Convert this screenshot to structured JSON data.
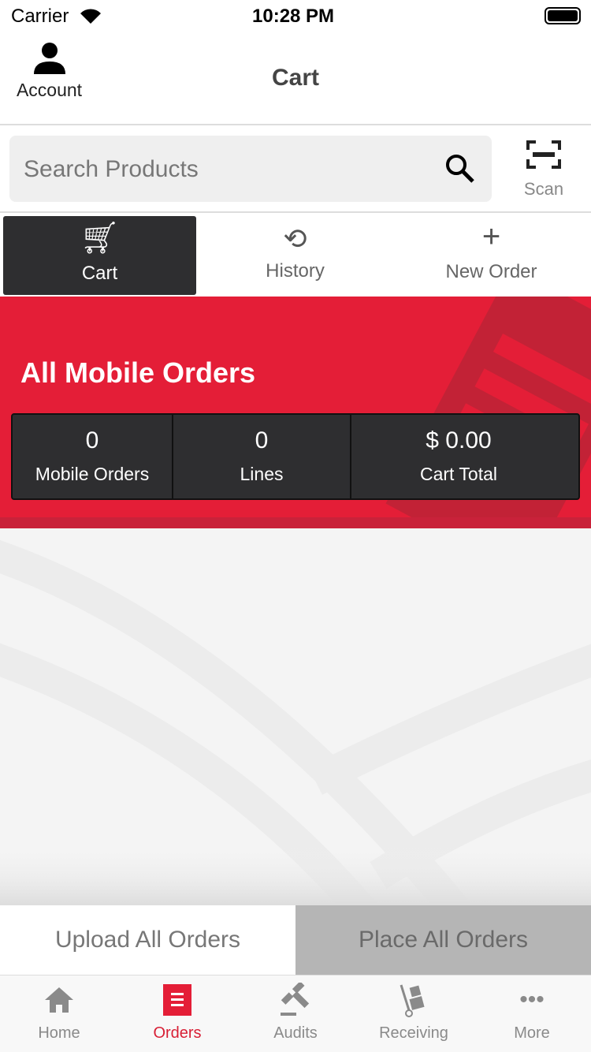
{
  "status": {
    "carrier": "Carrier",
    "time": "10:28 PM"
  },
  "header": {
    "account_label": "Account",
    "title": "Cart"
  },
  "search": {
    "placeholder": "Search Products",
    "scan_label": "Scan"
  },
  "tabs": [
    {
      "label": "Cart"
    },
    {
      "label": "History"
    },
    {
      "label": "New Order"
    }
  ],
  "banner": {
    "title": "All Mobile Orders"
  },
  "stats": [
    {
      "value": "0",
      "label": "Mobile Orders"
    },
    {
      "value": "0",
      "label": "Lines"
    },
    {
      "value": "$ 0.00",
      "label": "Cart Total"
    }
  ],
  "actions": {
    "upload": "Upload All Orders",
    "place": "Place All Orders"
  },
  "tabbar": [
    {
      "label": "Home"
    },
    {
      "label": "Orders"
    },
    {
      "label": "Audits"
    },
    {
      "label": "Receiving"
    },
    {
      "label": "More"
    }
  ],
  "colors": {
    "accent": "#e41e37",
    "dark": "#2e2e30"
  }
}
